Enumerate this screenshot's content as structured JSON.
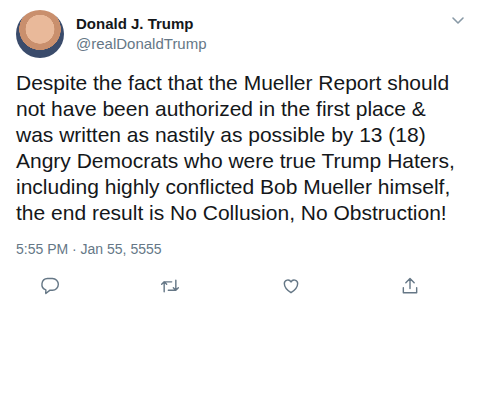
{
  "user": {
    "name": "Donald J. Trump",
    "handle": "@realDonaldTrump"
  },
  "tweet": {
    "text": "Despite the fact that the Mueller Report should not have been authorized in the first place & was written as nastily as possible by 13 (18) Angry Democrats who were true Trump Haters, including highly conflicted Bob Mueller himself, the end result is No Collusion, No Obstruction!",
    "timestamp": "5:55 PM · Jan 55, 5555"
  }
}
